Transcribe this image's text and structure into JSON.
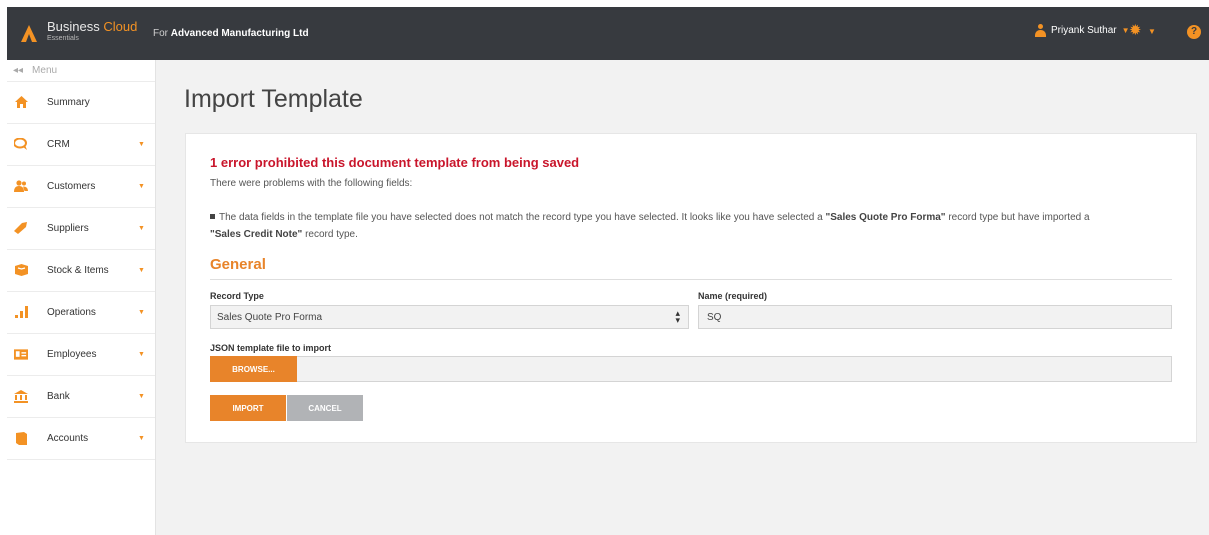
{
  "topbar": {
    "brand_main": "Business",
    "brand_accent": "Cloud",
    "brand_sub": "Essentials",
    "company_prefix": "For",
    "company_name": "Advanced Manufacturing Ltd",
    "user_name": "Priyank Suthar",
    "help_glyph": "?",
    "icons": [
      "logo-icon",
      "user-icon",
      "gear-icon",
      "help-icon"
    ]
  },
  "sidebar": {
    "menu_label": "Menu",
    "items": [
      {
        "label": "Summary",
        "icon": "home-icon",
        "has_caret": false
      },
      {
        "label": "CRM",
        "icon": "chat-icon",
        "has_caret": true
      },
      {
        "label": "Customers",
        "icon": "people-icon",
        "has_caret": true
      },
      {
        "label": "Suppliers",
        "icon": "tag-icon",
        "has_caret": true
      },
      {
        "label": "Stock & Items",
        "icon": "box-icon",
        "has_caret": true
      },
      {
        "label": "Operations",
        "icon": "bar-chart-icon",
        "has_caret": true
      },
      {
        "label": "Employees",
        "icon": "id-card-icon",
        "has_caret": true
      },
      {
        "label": "Bank",
        "icon": "bank-icon",
        "has_caret": true
      },
      {
        "label": "Accounts",
        "icon": "book-icon",
        "has_caret": true
      }
    ]
  },
  "main": {
    "page_title": "Import Template",
    "error": {
      "title": "1 error prohibited this document template from being saved",
      "subtitle": "There were problems with the following fields:",
      "message_part1": "The data fields in the template file you have selected does not match the record type you have selected. It looks like you have selected a ",
      "message_bold1": "\"Sales Quote Pro Forma\"",
      "message_part2": " record type but have imported a ",
      "message_bold2": "\"Sales Credit Note\"",
      "message_part3": " record type."
    },
    "section_title": "General",
    "form": {
      "record_type_label": "Record Type",
      "record_type_value": "Sales Quote Pro Forma",
      "name_label": "Name (required)",
      "name_value": "SQ",
      "json_label": "JSON template file to import",
      "browse_label": "BROWSE..."
    },
    "buttons": {
      "import_label": "IMPORT",
      "cancel_label": "CANCEL"
    }
  },
  "colors": {
    "accent": "#e8842a",
    "topbar": "#373a3f",
    "error": "#c9152b",
    "cancel": "#b1b3b6"
  }
}
